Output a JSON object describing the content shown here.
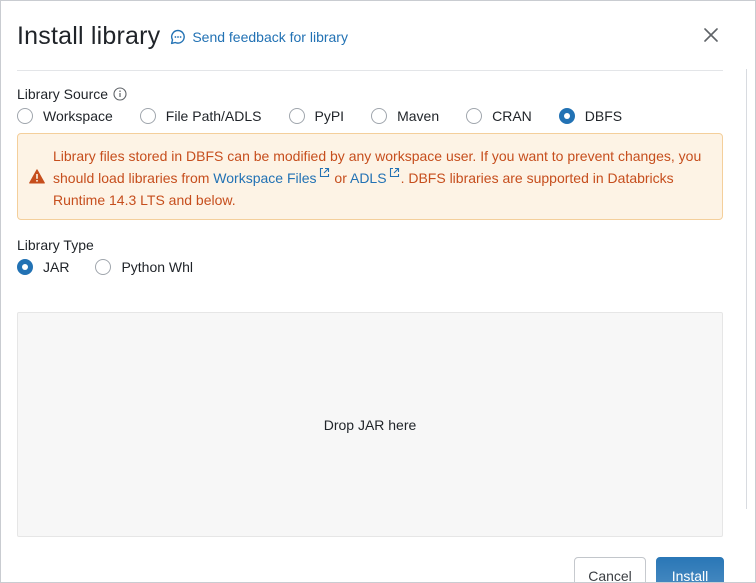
{
  "dialog": {
    "title": "Install library",
    "feedback_link": "Send feedback for library"
  },
  "library_source": {
    "label": "Library Source",
    "options": [
      "Workspace",
      "File Path/ADLS",
      "PyPI",
      "Maven",
      "CRAN",
      "DBFS"
    ],
    "selected": "DBFS"
  },
  "alert": {
    "text_before": "Library files stored in DBFS can be modified by any workspace user. If you want to prevent changes, you should load libraries from ",
    "link1": "Workspace Files",
    "text_middle": " or ",
    "link2": "ADLS",
    "text_after": ". DBFS libraries are supported in Databricks Runtime 14.3 LTS and below."
  },
  "library_type": {
    "label": "Library Type",
    "options": [
      "JAR",
      "Python Whl"
    ],
    "selected": "JAR"
  },
  "dropzone": {
    "text": "Drop JAR here"
  },
  "footer": {
    "cancel_label": "Cancel",
    "install_label": "Install"
  },
  "colors": {
    "accent": "#2272b4",
    "warning_text": "#c64e1d",
    "warning_bg": "#fdf3e5",
    "warning_border": "#f4cf9b"
  }
}
